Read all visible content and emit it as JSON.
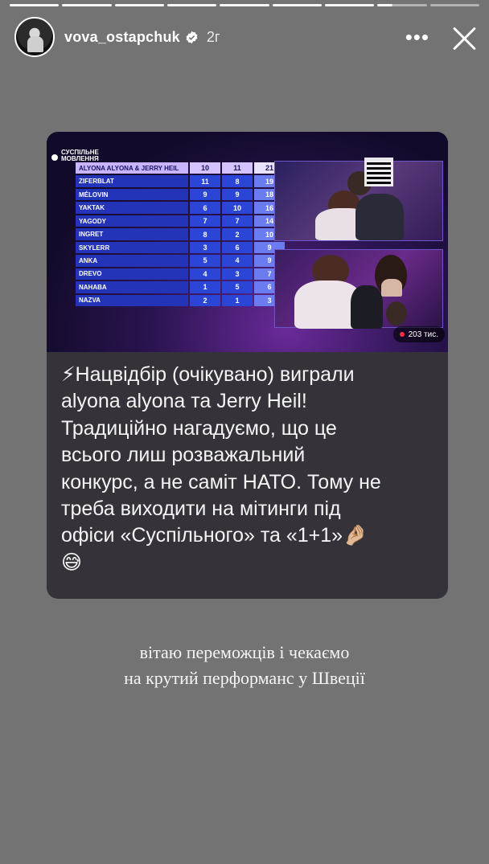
{
  "progress": {
    "segments": 9,
    "current_index": 7
  },
  "header": {
    "username": "vova_ostapchuk",
    "time_ago": "2г",
    "more_glyph": "•••"
  },
  "shared_post": {
    "broadcaster": [
      "СУСПІЛЬНЕ",
      "МОВЛЕННЯ"
    ],
    "results": [
      {
        "name": "ALYONA ALYONA & JERRY HEIL",
        "jury": "10",
        "audience": "11",
        "total": "21"
      },
      {
        "name": "ZIFERBLAT",
        "jury": "11",
        "audience": "8",
        "total": "19"
      },
      {
        "name": "MÉLOVIN",
        "jury": "9",
        "audience": "9",
        "total": "18"
      },
      {
        "name": "YAKTAK",
        "jury": "6",
        "audience": "10",
        "total": "16"
      },
      {
        "name": "YAGODY",
        "jury": "7",
        "audience": "7",
        "total": "14"
      },
      {
        "name": "INGRET",
        "jury": "8",
        "audience": "2",
        "total": "10"
      },
      {
        "name": "SKYLERR",
        "jury": "3",
        "audience": "6",
        "total": "9"
      },
      {
        "name": "ANKA",
        "jury": "5",
        "audience": "4",
        "total": "9"
      },
      {
        "name": "DREVO",
        "jury": "4",
        "audience": "3",
        "total": "7"
      },
      {
        "name": "NAHABA",
        "jury": "1",
        "audience": "5",
        "total": "6"
      },
      {
        "name": "NAZVA",
        "jury": "2",
        "audience": "1",
        "total": "3"
      }
    ],
    "viewers": "203 тис.",
    "text_lines": [
      "⚡Нацвідбір (очікувано) виграли",
      "alyona alyona та Jerry Heil!",
      "Традиційно нагадуємо, що це",
      "всього лиш розважальний",
      "конкурс, а не саміт НАТО. Тому не",
      "треба виходити на мітинги під",
      "офіси «Суспільного» та «1+1»🤌🏼",
      "😅"
    ]
  },
  "caption": {
    "line1": "вітаю переможців і чекаємо",
    "line2": "на крутий перформанс у Швеції"
  },
  "colors": {
    "background": "#737373",
    "card": "#35323a",
    "table_row": "#2434b8",
    "winner_row": "#c9b4ff"
  }
}
